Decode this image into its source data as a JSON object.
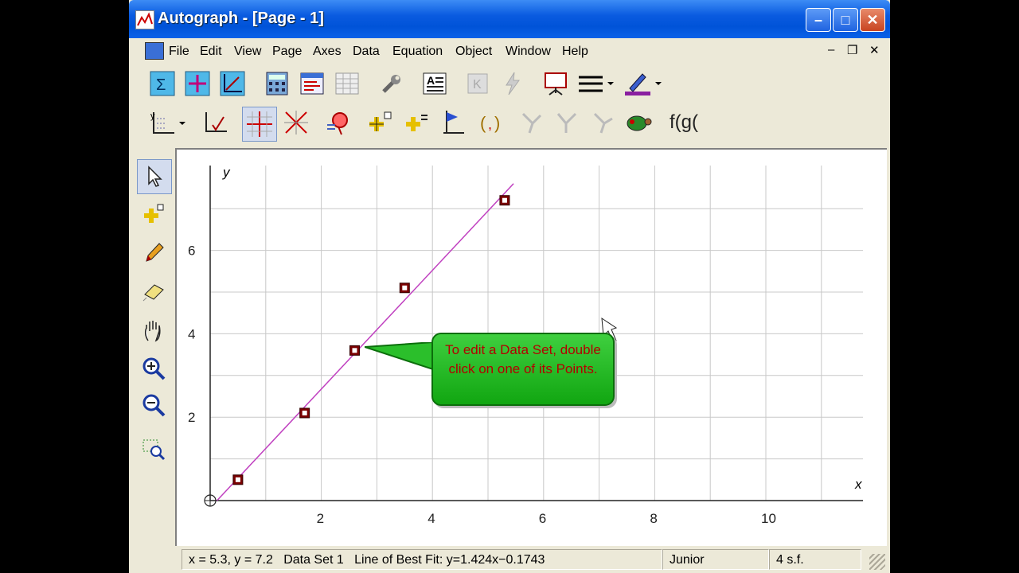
{
  "window": {
    "title": "Autograph - [Page - 1]"
  },
  "menu": {
    "items": [
      "File",
      "Edit",
      "View",
      "Page",
      "Axes",
      "Data",
      "Equation",
      "Object",
      "Window",
      "Help"
    ]
  },
  "toolbar": {
    "row1": [
      "sigma-icon",
      "plus-grid-icon",
      "axes-icon",
      "calculator-icon",
      "table-icon",
      "grid-icon",
      "wrench-icon",
      "text-icon",
      "k-icon",
      "lightning-icon",
      "slideshow-icon",
      "line-style-icon",
      "pen-color-icon"
    ],
    "row2": [
      "axis-options-icon",
      "axes-tick-icon",
      "crosshair-icon",
      "cross-icon",
      "zoom-point-icon",
      "add-points-icon",
      "add-point-equals-icon",
      "flag-icon",
      "bracket-icon",
      "tool1-icon",
      "tool2-icon",
      "tool3-icon",
      "turtle-icon"
    ],
    "fg_label": "f(g("
  },
  "lefttools": [
    "select-arrow-icon",
    "add-point-icon",
    "pencil-icon",
    "eraser-icon",
    "hand-icon",
    "zoom-in-icon",
    "zoom-out-icon",
    "zoom-box-icon"
  ],
  "graph": {
    "x_label": "x",
    "y_label": "y",
    "x_ticks": [
      "2",
      "4",
      "6",
      "8",
      "10"
    ],
    "y_ticks": [
      "2",
      "4",
      "6"
    ],
    "callout": "To edit a Data Set, double click on one of its Points.",
    "line_color": "#c040c0",
    "point_color": "#7a0000"
  },
  "chart_data": {
    "type": "scatter",
    "title": "",
    "xlabel": "x",
    "ylabel": "y",
    "xlim": [
      0,
      11.7
    ],
    "ylim": [
      0,
      7.9
    ],
    "series": [
      {
        "name": "Data Set 1",
        "x": [
          0.5,
          1.7,
          2.6,
          3.5,
          5.3
        ],
        "y": [
          0.5,
          2.1,
          3.6,
          5.1,
          7.2
        ]
      }
    ],
    "best_fit": {
      "slope": 1.424,
      "intercept": -0.1743,
      "label": "Line of Best Fit: y=1.424x−0.1743"
    }
  },
  "status": {
    "coords": "x = 5.3, y = 7.2",
    "dataset": "Data Set 1",
    "fit": "Line of Best Fit: y=1.424x−0.1743",
    "level": "Junior",
    "sf": "4 s.f."
  }
}
